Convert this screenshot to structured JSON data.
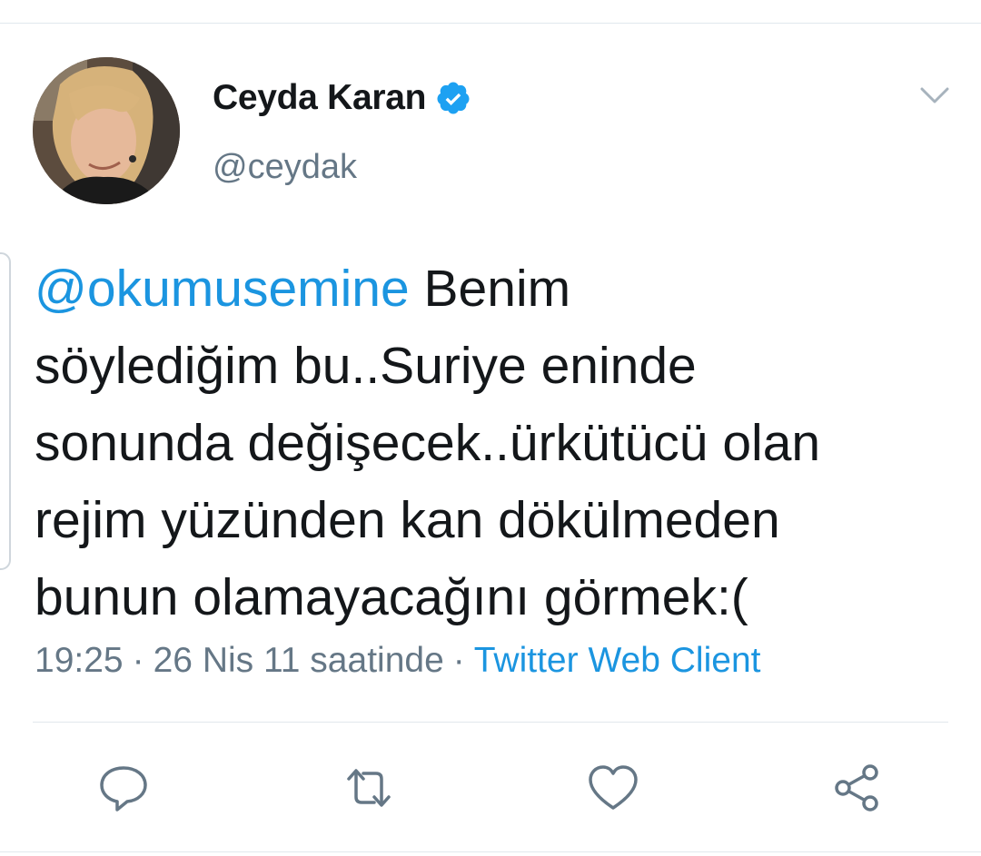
{
  "tweet": {
    "author": {
      "display_name": "Ceyda Karan",
      "handle": "@ceydak",
      "verified": true,
      "avatar_description": "profile photo"
    },
    "text": {
      "mention": "@okumusemine",
      "line1_rest": " Benim",
      "line2": "söylediğim bu..Suriye eninde",
      "line3": "sonunda değişecek..ürkütücü olan",
      "line4": "rejim yüzünden kan dökülmeden",
      "line5": "bunun olamayacağını görmek:("
    },
    "meta": {
      "time": "19:25",
      "date": "26 Nis 11 saatinde",
      "separator": "·",
      "source": "Twitter Web Client"
    },
    "actions": {
      "reply_icon": "reply-icon",
      "retweet_icon": "retweet-icon",
      "like_icon": "heart-icon",
      "share_icon": "share-icon"
    }
  },
  "colors": {
    "accent": "#1b95e0",
    "text": "#14171a",
    "secondary": "#657786",
    "divider": "#e1e8ed",
    "icon": "#657786"
  }
}
